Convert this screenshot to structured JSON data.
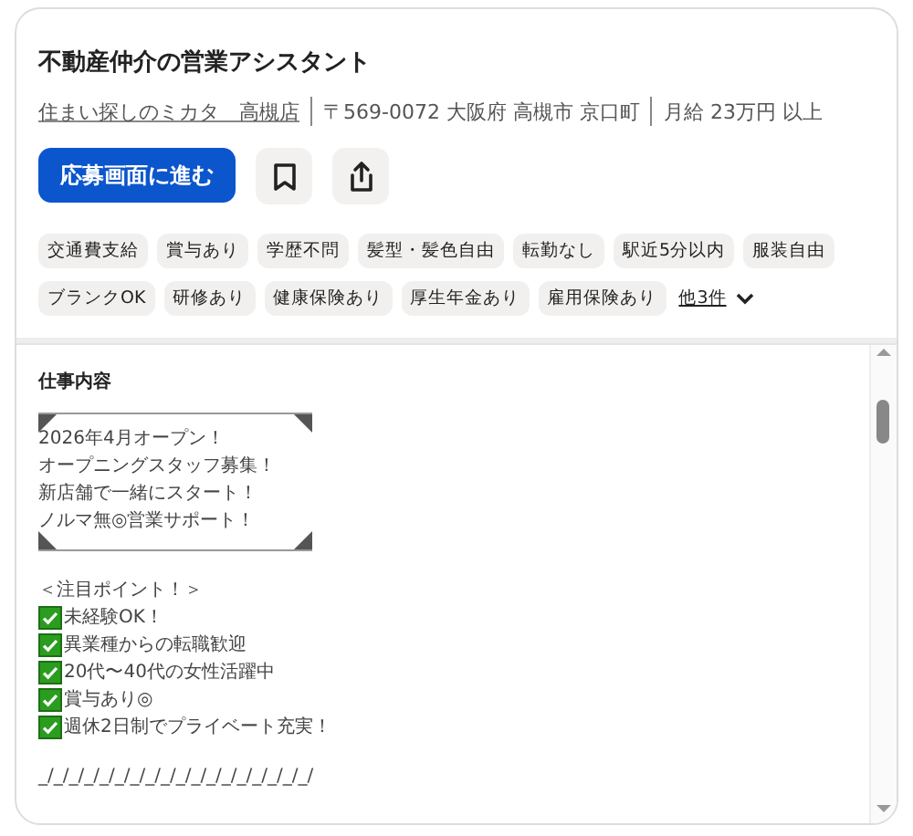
{
  "job": {
    "title": "不動産仲介の営業アシスタント",
    "company": "住まい探しのミカタ　高槻店",
    "address": "〒569-0072 大阪府 高槻市 京口町",
    "salary": "月給 23万円 以上",
    "apply_button": "応募画面に進む"
  },
  "tags": [
    "交通費支給",
    "賞与あり",
    "学歴不問",
    "髪型・髪色自由",
    "転勤なし",
    "駅近5分以内",
    "服装自由",
    "ブランクOK",
    "研修あり",
    "健康保険あり",
    "厚生年金あり",
    "雇用保険あり"
  ],
  "more_tags": "他3件",
  "description": {
    "heading": "仕事内容",
    "framed_lines": [
      "2026年4月オープン！",
      "オープニングスタッフ募集！",
      "新店舗で一緒にスタート！",
      "ノルマ無◎営業サポート！"
    ],
    "points_heading": "＜注目ポイント！＞",
    "points": [
      "未経験OK！",
      "異業種からの転職歓迎",
      "20代〜40代の女性活躍中",
      "賞与あり◎",
      "週休2日制でプライベート充実！"
    ],
    "separator": "_/_/_/_/_/_/_/_/_/_/_/_/_/_/_/_/_/_/"
  }
}
